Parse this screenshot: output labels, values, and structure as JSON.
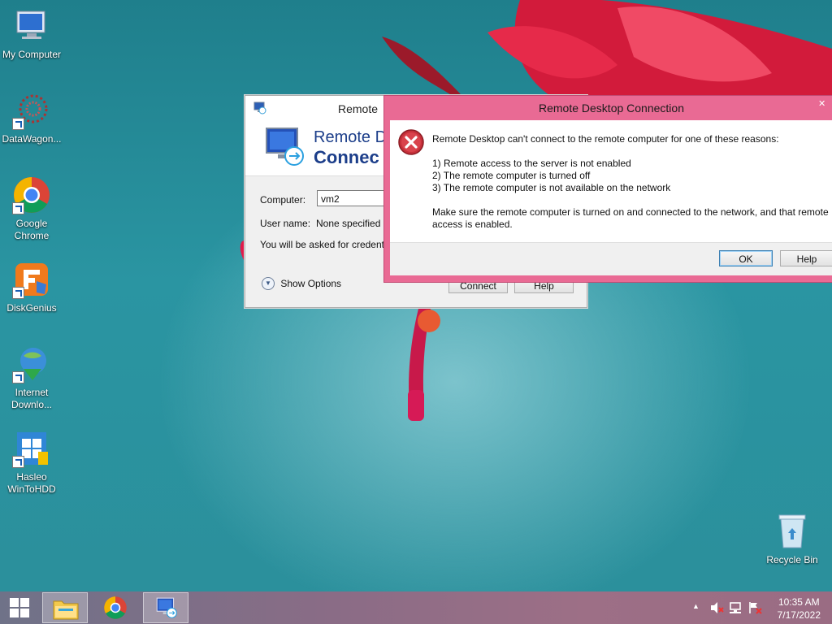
{
  "desktop": {
    "icons": [
      {
        "label": "My Computer"
      },
      {
        "label": "DataWagon..."
      },
      {
        "label": "Google Chrome"
      },
      {
        "label": "DiskGenius"
      },
      {
        "label": "Internet Downlo..."
      },
      {
        "label": "Hasleo WinToHDD"
      }
    ],
    "recycle_bin": "Recycle Bin"
  },
  "rdc_window": {
    "title": "Remote",
    "banner_line1": "Remote D",
    "banner_line2": "Connec",
    "computer_label": "Computer:",
    "computer_value": "vm2",
    "username_label": "User name:",
    "username_value": "None specified",
    "credentials_note": "You will be asked for credentials",
    "show_options": "Show Options",
    "connect_button": "Connect",
    "help_button": "Help"
  },
  "error_dialog": {
    "title": "Remote Desktop Connection",
    "close_glyph": "✕",
    "message": "Remote Desktop can't connect to the remote computer for one of these reasons:",
    "reasons": [
      "1) Remote access to the server is not enabled",
      "2) The remote computer is turned off",
      "3) The remote computer is not available on the network"
    ],
    "advice_line1": "Make sure the remote computer is turned on and connected to the network, and that remote",
    "advice_line2": "access is enabled.",
    "ok_button": "OK",
    "help_button": "Help"
  },
  "taskbar": {
    "tray_arrow": "▲",
    "time": "10:35 AM",
    "date": "7/17/2022"
  },
  "colors": {
    "error_frame": "#e96a94",
    "accent_blue": "#1c3e8a"
  }
}
